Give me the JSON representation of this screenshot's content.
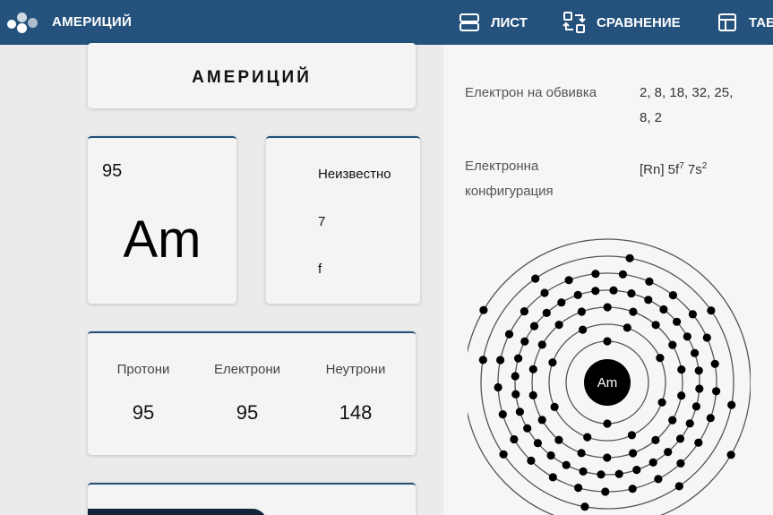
{
  "header": {
    "app_title": "АМЕРИЦИЙ",
    "nav": [
      {
        "label": "ЛИСТ",
        "icon": "list-icon"
      },
      {
        "label": "СРАВНЕНИЕ",
        "icon": "compare-icon"
      },
      {
        "label": "ТАБ",
        "icon": "table-icon"
      }
    ]
  },
  "element": {
    "name": "АМЕРИЦИЙ",
    "atomic_number": "95",
    "symbol": "Am",
    "properties": [
      "Неизвестно",
      "7",
      "f"
    ],
    "counts": [
      {
        "label": "Протони",
        "value": "95"
      },
      {
        "label": "Електрони",
        "value": "95"
      },
      {
        "label": "Неутрони",
        "value": "148"
      }
    ]
  },
  "details": {
    "shell_label": "Електрон на обвивка",
    "shell_value_line1": "2, 8, 18, 32, 25,",
    "shell_value_line2": "8, 2",
    "config_label_line1": "Електронна",
    "config_label_line2": "конфигурация",
    "config_core": "[Rn] 5f",
    "config_exp1": "7",
    "config_mid": " 7s",
    "config_exp2": "2"
  },
  "atom_diagram": {
    "nucleus_label": "Am",
    "shells": [
      2,
      8,
      18,
      32,
      25,
      8,
      2
    ]
  },
  "colors": {
    "topbar": "#24527d",
    "accent_border": "#1f4f78",
    "nucleus": "#000000"
  }
}
